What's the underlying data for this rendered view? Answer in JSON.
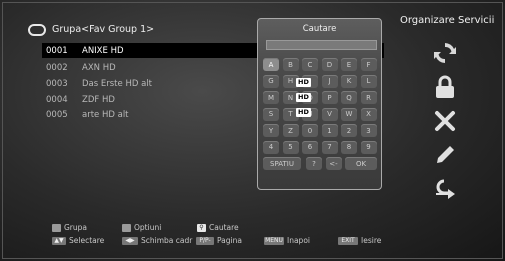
{
  "header": {
    "group_title": "Grupa<Fav Group 1>"
  },
  "right_panel": {
    "title": "Organizare Servicii"
  },
  "channels": [
    {
      "num": "0001",
      "name": "ANIXE HD"
    },
    {
      "num": "0002",
      "name": "AXN HD"
    },
    {
      "num": "0003",
      "name": "Das Erste HD alt"
    },
    {
      "num": "0004",
      "name": "ZDF HD"
    },
    {
      "num": "0005",
      "name": "arte HD alt"
    }
  ],
  "badges": {
    "hd": "HD"
  },
  "keyboard": {
    "title": "Cautare",
    "input_value": "",
    "rows": [
      [
        "A",
        "B",
        "C",
        "D",
        "E",
        "F"
      ],
      [
        "G",
        "H",
        "I",
        "J",
        "K",
        "L"
      ],
      [
        "M",
        "N",
        "O",
        "P",
        "Q",
        "R"
      ],
      [
        "S",
        "T",
        "U",
        "V",
        "W",
        "X"
      ],
      [
        "Y",
        "Z",
        "0",
        "1",
        "2",
        "3"
      ],
      [
        "4",
        "5",
        "6",
        "7",
        "8",
        "9"
      ]
    ],
    "space_label": "SPATIU",
    "question_label": "?",
    "back_label": "<-",
    "ok_label": "OK",
    "selected_key": "A"
  },
  "side_icons": [
    "refresh-icon",
    "lock-icon",
    "delete-icon",
    "edit-icon",
    "move-icon"
  ],
  "footer": {
    "red_label": "Grupa",
    "green_label": "Optiuni",
    "search_label": "Cautare",
    "select_label": "Selectare",
    "switch_label": "Schimba cadr",
    "page_chip": "P/P-",
    "page_label": "Pagina",
    "menu_chip": "MENU",
    "back_label": "Inapoi",
    "exit_chip": "EXIT",
    "exit_label": "Iesire"
  },
  "colors": {
    "selected_row": "#000000",
    "key_selected": "#8d8d8d"
  }
}
